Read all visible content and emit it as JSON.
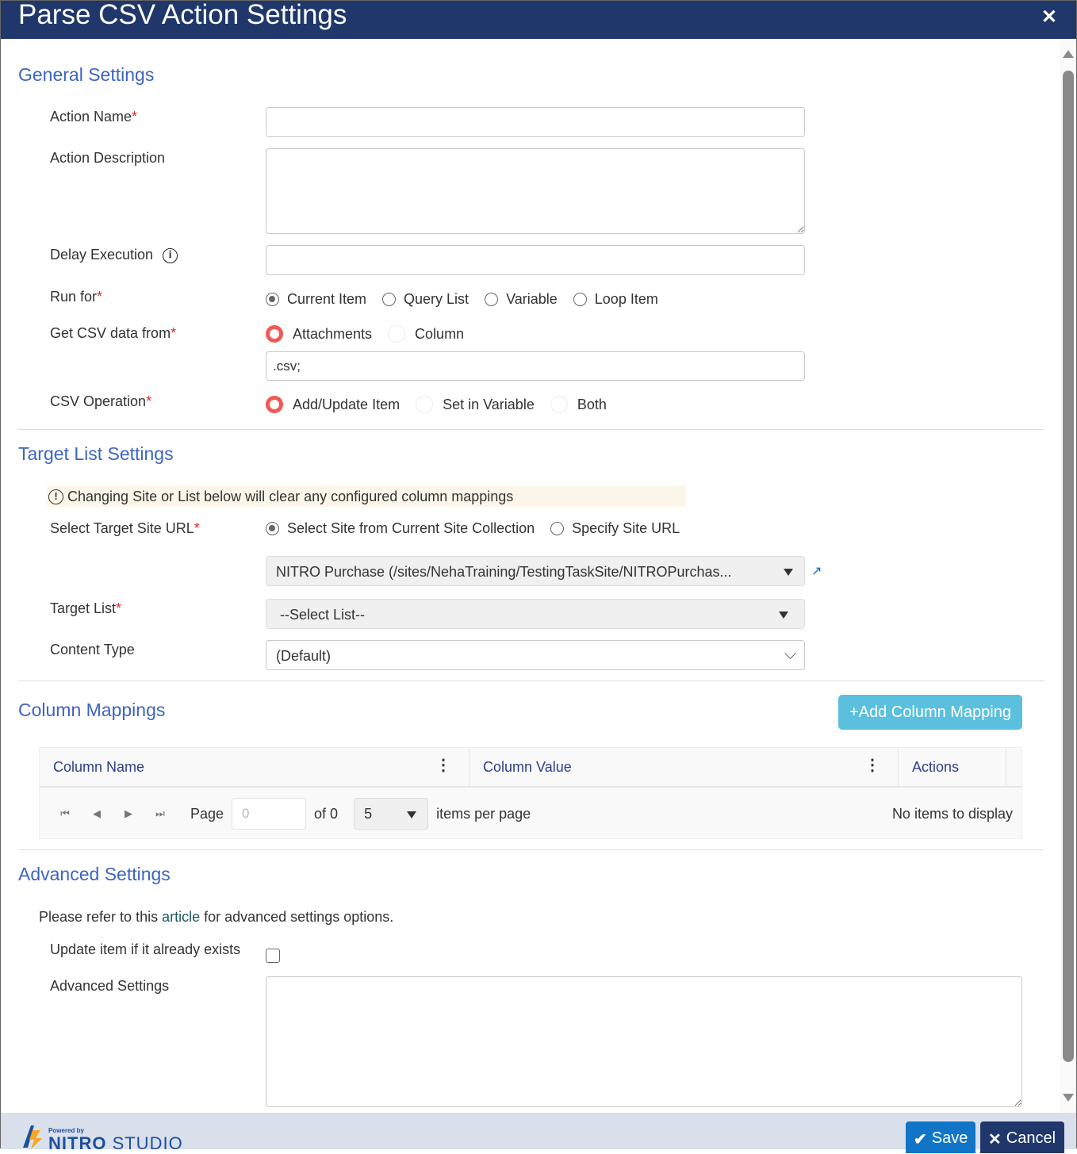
{
  "dialog": {
    "title": "Parse CSV Action Settings",
    "close_icon": "close-icon"
  },
  "general": {
    "section_title": "General Settings",
    "action_name_label": "Action Name",
    "action_name_value": "",
    "action_description_label": "Action Description",
    "action_description_value": "",
    "delay_execution_label": "Delay Execution",
    "delay_execution_value": "",
    "info_icon": "i",
    "run_for_label": "Run for",
    "run_for_options": [
      "Current Item",
      "Query List",
      "Variable",
      "Loop Item"
    ],
    "run_for_selected": "Current Item",
    "csv_source_label": "Get CSV data from",
    "csv_source_options": [
      "Attachments",
      "Column"
    ],
    "csv_source_selected": "Attachments",
    "attachment_filter_value": ".csv;",
    "csv_operation_label": "CSV Operation",
    "csv_operation_options": [
      "Add/Update Item",
      "Set in Variable",
      "Both"
    ],
    "csv_operation_selected": "Add/Update Item",
    "required_mark": "*"
  },
  "target": {
    "section_title": "Target List Settings",
    "warning_icon": "!",
    "warning_text": "Changing Site or List below will clear any configured column mappings",
    "site_url_label": "Select Target Site URL",
    "site_url_options": [
      "Select Site from Current Site Collection",
      "Specify Site URL"
    ],
    "site_url_selected": "Select Site from Current Site Collection",
    "site_dropdown_value": "NITRO Purchase (/sites/NehaTraining/TestingTaskSite/NITROPurchas...",
    "external_link_icon": "↗",
    "target_list_label": "Target List",
    "target_list_value": "--Select List--",
    "content_type_label": "Content Type",
    "content_type_value": "(Default)",
    "chevron": "⌵"
  },
  "mappings": {
    "section_title": "Column Mappings",
    "add_button_label": "+Add Column Mapping",
    "columns": [
      "Column Name",
      "Column Value",
      "Actions"
    ],
    "menu_glyph": "⋮",
    "pager": {
      "first": "⏮",
      "prev": "◀",
      "next": "▶",
      "last": "⏭",
      "page_label": "Page",
      "page_value": "0",
      "of_label": "of 0",
      "per_page_value": "5",
      "per_page_label": "items per page",
      "status": "No items to display"
    }
  },
  "advanced": {
    "section_title": "Advanced Settings",
    "refer_prefix": "Please refer to this ",
    "refer_link": "article",
    "refer_suffix": " for advanced settings options.",
    "update_item_label": "Update item if it already exists",
    "update_item_checked": false,
    "advanced_settings_label": "Advanced Settings",
    "advanced_settings_value": ""
  },
  "footer": {
    "powered_by": "Powered by",
    "brand_bold": "NITRO",
    "brand_light": " STUDIO",
    "save_label": "Save",
    "save_icon": "✔",
    "cancel_label": "Cancel",
    "cancel_icon": "✕"
  },
  "colors": {
    "titlebar": "#1f376b",
    "section_title": "#3d64c4",
    "radio_accent": "#f05a55",
    "add_button": "#5bc0de",
    "save_button": "#1075c6",
    "cancel_button": "#1f376b"
  }
}
